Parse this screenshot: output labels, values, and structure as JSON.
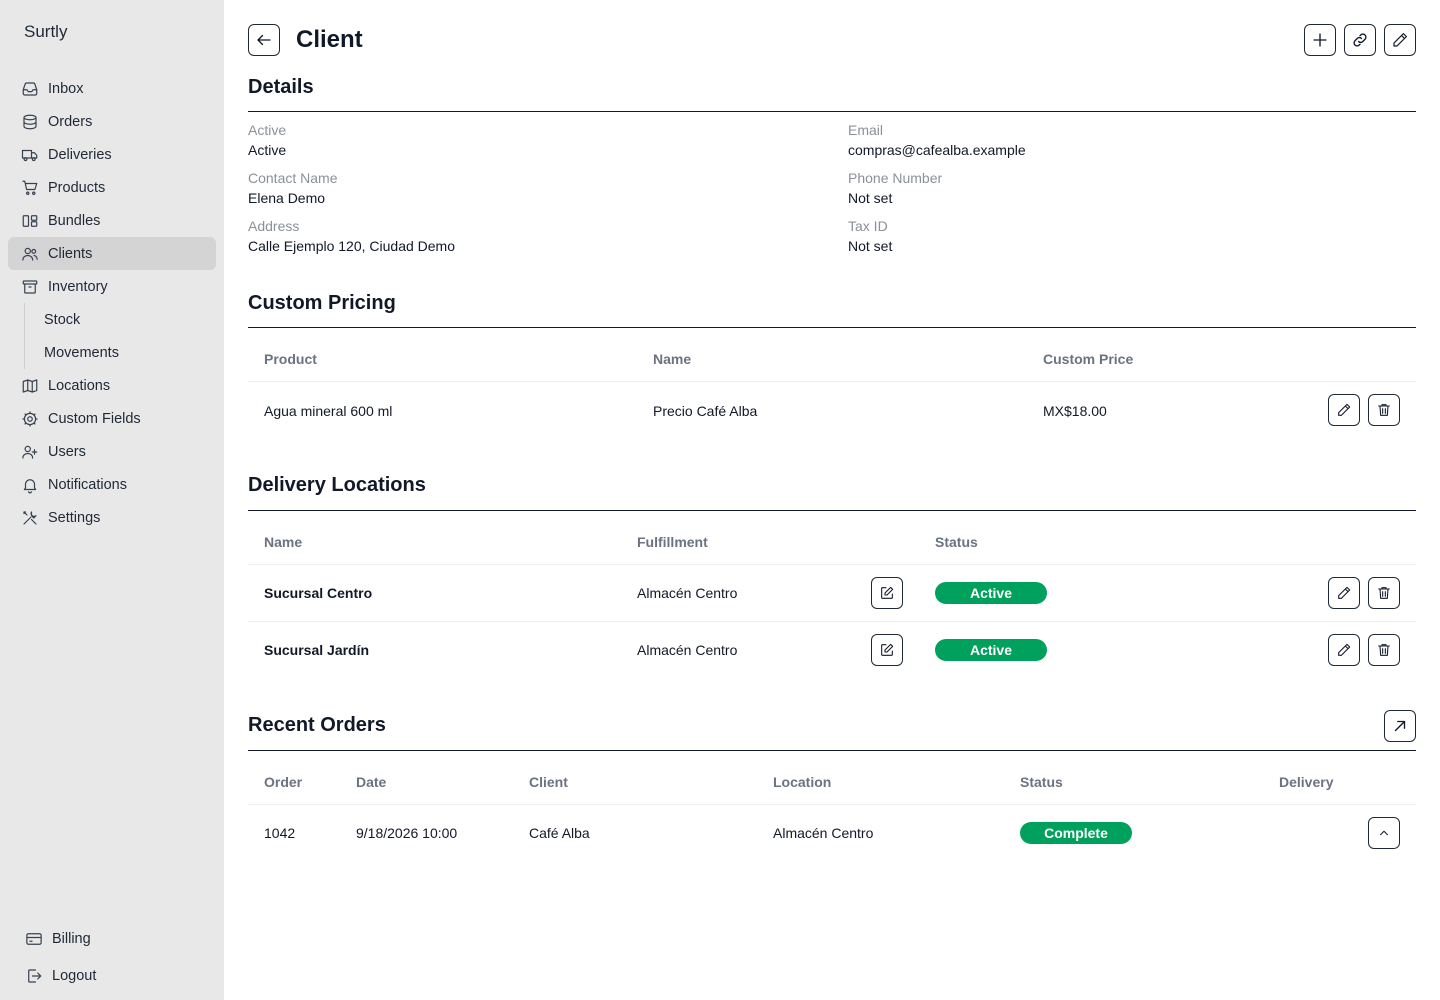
{
  "app": {
    "brand": "Surtly"
  },
  "sidebar": {
    "items": [
      {
        "label": "Inbox",
        "icon": "inbox-icon"
      },
      {
        "label": "Orders",
        "icon": "database-icon"
      },
      {
        "label": "Deliveries",
        "icon": "truck-icon"
      },
      {
        "label": "Products",
        "icon": "cart-icon"
      },
      {
        "label": "Bundles",
        "icon": "bundle-icon"
      },
      {
        "label": "Clients",
        "icon": "users-icon",
        "active": true
      },
      {
        "label": "Inventory",
        "icon": "archive-icon"
      },
      {
        "label": "Stock"
      },
      {
        "label": "Movements"
      },
      {
        "label": "Locations",
        "icon": "map-icon"
      },
      {
        "label": "Custom Fields",
        "icon": "cog-icon"
      },
      {
        "label": "Users",
        "icon": "user-plus-icon"
      },
      {
        "label": "Notifications",
        "icon": "bell-icon"
      },
      {
        "label": "Settings",
        "icon": "tools-icon"
      }
    ],
    "bottom": [
      {
        "label": "Billing",
        "icon": "credit-card-icon"
      },
      {
        "label": "Logout",
        "icon": "logout-icon"
      }
    ]
  },
  "page": {
    "title": "Client"
  },
  "details": {
    "title": "Details",
    "fields": {
      "active": {
        "label": "Active",
        "value": "Active"
      },
      "email": {
        "label": "Email",
        "value": "compras@cafealba.example"
      },
      "contact": {
        "label": "Contact Name",
        "value": "Elena Demo"
      },
      "phone": {
        "label": "Phone Number",
        "value": "Not set"
      },
      "address": {
        "label": "Address",
        "value": "Calle Ejemplo 120, Ciudad Demo"
      },
      "tax": {
        "label": "Tax ID",
        "value": "Not set"
      }
    }
  },
  "pricing": {
    "title": "Custom Pricing",
    "headers": {
      "product": "Product",
      "name": "Name",
      "price": "Custom Price"
    },
    "rows": [
      {
        "product": "Agua mineral 600 ml",
        "name": "Precio Café Alba",
        "price": "MX$18.00"
      }
    ]
  },
  "locations": {
    "title": "Delivery Locations",
    "headers": {
      "name": "Name",
      "fulfillment": "Fulfillment",
      "status": "Status"
    },
    "rows": [
      {
        "name": "Sucursal Centro",
        "fulfillment": "Almacén Centro",
        "status": "Active"
      },
      {
        "name": "Sucursal Jardín",
        "fulfillment": "Almacén Centro",
        "status": "Active"
      }
    ]
  },
  "orders": {
    "title": "Recent Orders",
    "headers": {
      "order": "Order",
      "date": "Date",
      "client": "Client",
      "location": "Location",
      "status": "Status",
      "delivery": "Delivery"
    },
    "rows": [
      {
        "order": "1042",
        "date": "9/18/2026 10:00",
        "client": "Café Alba",
        "location": "Almacén Centro",
        "status": "Complete"
      }
    ]
  },
  "colors": {
    "status_green": "#00a15d",
    "sidebar_bg": "#e8e8e8",
    "active_item_bg": "#d4d4d4"
  }
}
